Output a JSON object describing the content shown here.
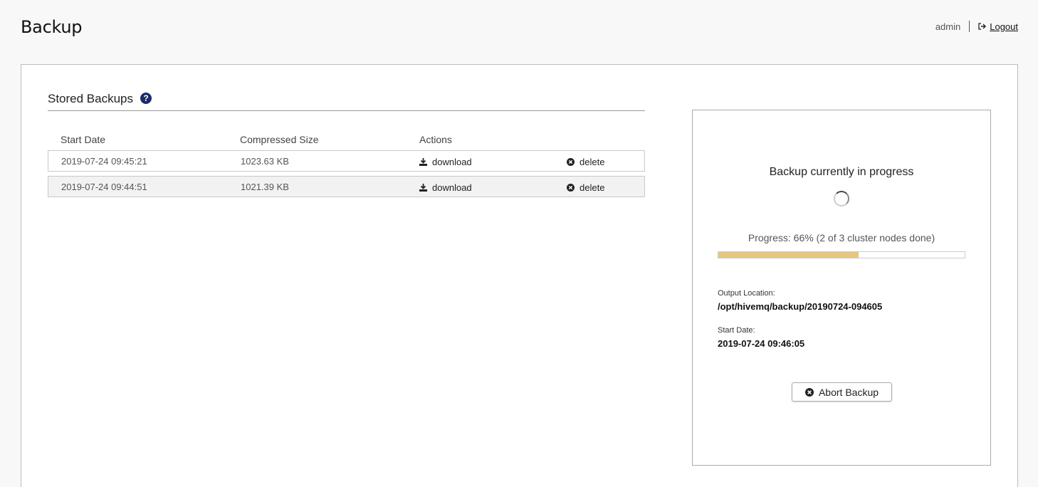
{
  "header": {
    "title": "Backup",
    "username": "admin",
    "logout_label": "Logout"
  },
  "stored_backups": {
    "title": "Stored Backups",
    "columns": [
      "Start Date",
      "Compressed Size",
      "Actions"
    ],
    "rows": [
      {
        "start_date": "2019-07-24 09:45:21",
        "size": "1023.63 KB",
        "download_label": "download",
        "delete_label": "delete"
      },
      {
        "start_date": "2019-07-24 09:44:51",
        "size": "1021.39 KB",
        "download_label": "download",
        "delete_label": "delete"
      }
    ]
  },
  "progress_panel": {
    "title": "Backup currently in progress",
    "progress_text": "Progress: 66% (2 of 3 cluster nodes done)",
    "progress_fraction": 0.57,
    "output_location_label": "Output Location:",
    "output_location": "/opt/hivemq/backup/20190724-094605",
    "start_date_label": "Start Date:",
    "start_date": "2019-07-24 09:46:05",
    "abort_label": "Abort Backup"
  },
  "colors": {
    "progress_fill": "#e6c77f",
    "help_icon": "#1f2a6b"
  }
}
